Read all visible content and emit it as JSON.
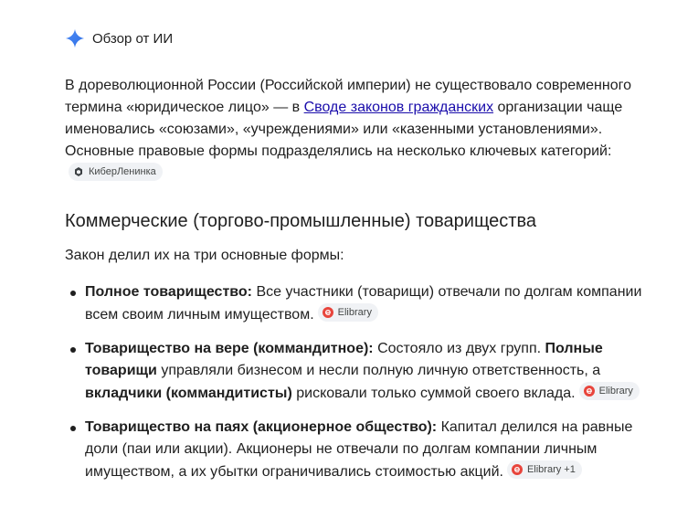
{
  "header": {
    "title": "Обзор от ИИ",
    "accent_color": "#4285f4",
    "icon": "sparkle-icon"
  },
  "intro": {
    "text_before_link": "В дореволюционной России (Российской империи) не существовало современного термина «юридическое лицо» — в ",
    "link_text": "Своде законов гражданских",
    "text_after_link": " организации чаще именовались «союзами», «учреждениями» или «казенными установлениями». Основные правовые формы подразделялись на несколько ключевых категорий:",
    "source_chip": "КиберЛенинка"
  },
  "section": {
    "title": "Коммерческие (торгово-промышленные) товарищества",
    "intro": "Закон делил их на три основные формы:"
  },
  "bullets": [
    {
      "term": "Полное товарищество:",
      "text": " Все участники (товарищи) отвечали по долгам компании всем своим личным имуществом.",
      "chip": "Elibrary"
    },
    {
      "term": "Товарищество на вере (коммандитное):",
      "text_1": " Состояло из двух групп. ",
      "strong_1": "Полные товарищи",
      "text_2": " управляли бизнесом и несли полную личную ответственность, а ",
      "strong_2": "вкладчики (коммандитисты)",
      "text_3": " рисковали только суммой своего вклада.",
      "chip": "Elibrary"
    },
    {
      "term": "Товарищество на паях (акционерное общество):",
      "text": " Капитал делился на равные доли (паи или акции). Акционеры не отвечали по долгам компании личным имуществом, а их убытки ограничивались стоимостью акций.",
      "chip": "Elibrary +1"
    }
  ],
  "colors": {
    "link": "#1a0dab",
    "chip_bg": "#f0f2f5",
    "elibrary_red": "#e8453c"
  }
}
